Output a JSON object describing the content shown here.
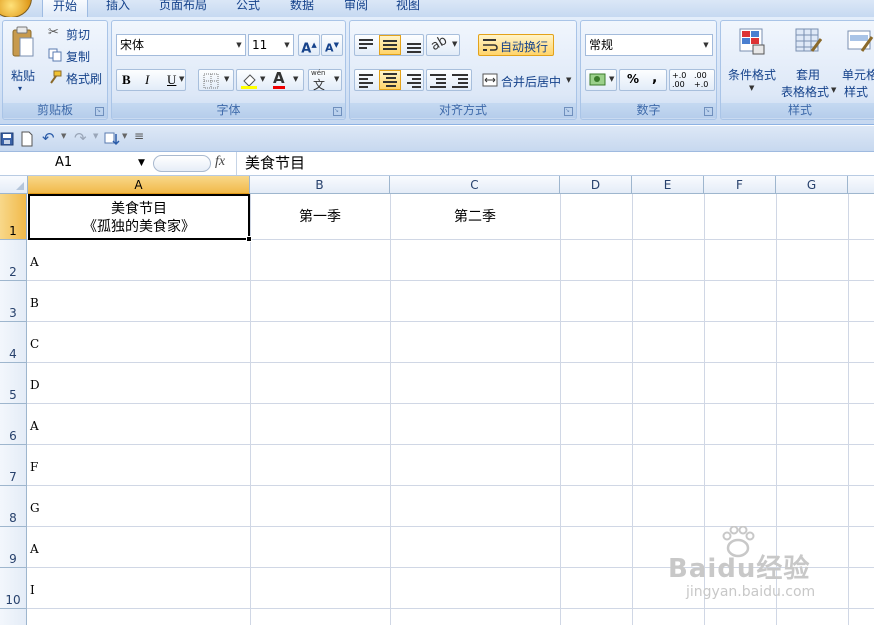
{
  "tabs": [
    "开始",
    "插入",
    "页面布局",
    "公式",
    "数据",
    "审阅",
    "视图"
  ],
  "ribbon": {
    "clipboard": {
      "label": "剪贴板",
      "paste": "粘贴",
      "cut": "剪切",
      "copy": "复制",
      "format_painter": "格式刷"
    },
    "font": {
      "label": "字体",
      "font_name": "宋体",
      "font_size": "11",
      "bold": "B",
      "italic": "I",
      "underline": "U",
      "grow": "A",
      "shrink": "A",
      "font_color": "A",
      "phonetic": "wén"
    },
    "alignment": {
      "label": "对齐方式",
      "wrap_text": "自动换行",
      "merge_center": "合并后居中"
    },
    "number": {
      "label": "数字",
      "format": "常规",
      "percent": "%",
      "comma": ",",
      "inc_decimal": "+.0 .00",
      "dec_decimal": ".00 +.0"
    },
    "styles": {
      "label": "样式",
      "conditional": "条件格式",
      "table_format_1": "套用",
      "table_format_2": "表格格式",
      "cell_style_1": "单元格",
      "cell_style_2": "样式"
    }
  },
  "formula_bar": {
    "name_box": "A1",
    "fx": "fx",
    "content": "美食节目"
  },
  "columns": [
    "A",
    "B",
    "C",
    "D",
    "E",
    "F",
    "G"
  ],
  "rows": [
    "1",
    "2",
    "3",
    "4",
    "5",
    "6",
    "7",
    "8",
    "9",
    "10"
  ],
  "cells": {
    "A1_line1": "美食节目",
    "A1_line2": "《孤独的美食家》",
    "B1": "第一季",
    "C1": "第二季",
    "col_a": [
      "A",
      "B",
      "C",
      "D",
      "A",
      "F",
      "G",
      "A",
      "I"
    ]
  },
  "watermark": {
    "brand": "Baidu经验",
    "url": "jingyan.baidu.com"
  }
}
